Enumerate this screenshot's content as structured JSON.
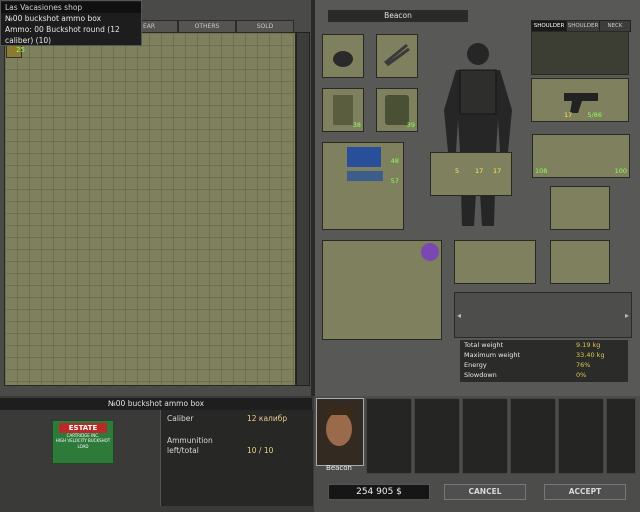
{
  "shop": {
    "tabs": [
      "",
      "EAR",
      "OTHERS",
      "SOLD"
    ],
    "tooltip": {
      "title": "Las Vacasiones shop",
      "line1": "№00 buckshot ammo box",
      "line2": "Ammo: 00 Buckshot round (12",
      "line3": "caliber) (10)"
    },
    "item_qty": "25"
  },
  "inventory": {
    "merc_name": "Beacon",
    "tabs": [
      "SHOULDER",
      "SHOULDER",
      "NECK"
    ],
    "pistol_ammo": "17",
    "pistol_cond": "5/86",
    "vest_cond": "38",
    "backpack_cond": "39",
    "case_cond": "48",
    "ammo_qty": "57",
    "grenades": [
      "5",
      "17",
      "17"
    ],
    "mags_left": "108",
    "mags_right": "100",
    "stats": [
      {
        "label": "Total weight",
        "value": "9.19 kg"
      },
      {
        "label": "Maximum weight",
        "value": "33.40 kg"
      },
      {
        "label": "Energy",
        "value": "76%"
      },
      {
        "label": "Slowdown",
        "value": "0%"
      }
    ]
  },
  "detail": {
    "title": "№00 buckshot ammo box",
    "brand": "ESTATE",
    "brand_sub": "CARTRIDGE INC.",
    "brand_desc": "HIGH VELOCITY BUCKSHOT LOAD",
    "caliber_label": "Caliber",
    "caliber_value": "12 калибр",
    "ammo_label": "Ammunition",
    "ammo_label2": "left/total",
    "ammo_value": "10 / 10"
  },
  "footer": {
    "merc_name": "Beacon",
    "money": "254 905 $",
    "cancel": "CANCEL",
    "accept": "ACCEPT"
  }
}
